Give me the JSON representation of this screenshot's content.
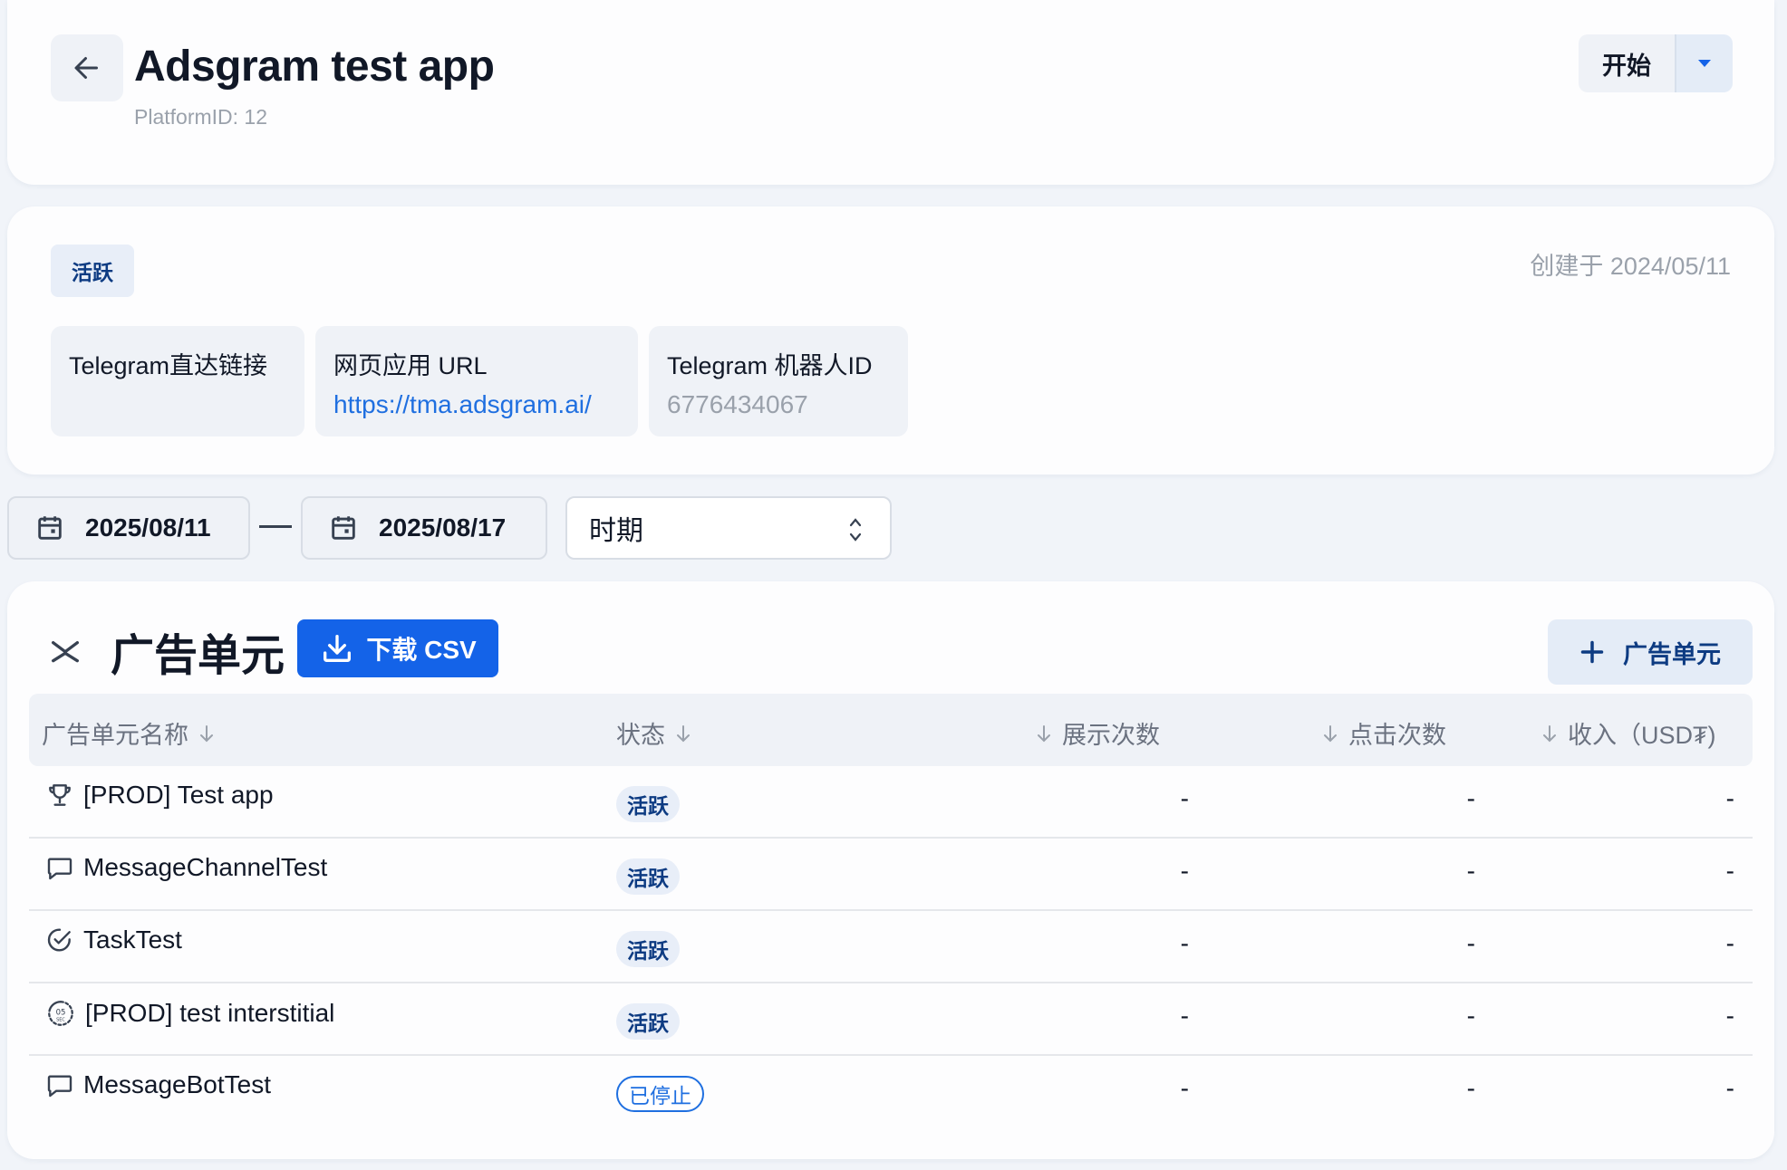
{
  "header": {
    "title": "Adsgram test app",
    "platform_id": "PlatformID: 12",
    "start_label": "开始"
  },
  "info": {
    "status": "活跃",
    "created": "创建于 2024/05/11",
    "tiles": [
      {
        "label": "Telegram直达链接",
        "value": ""
      },
      {
        "label": "网页应用 URL",
        "value": "https://tma.adsgram.ai/"
      },
      {
        "label": "Telegram 机器人ID",
        "value": "6776434067"
      }
    ]
  },
  "filters": {
    "start_date": "2025/08/11",
    "end_date": "2025/08/17",
    "period_label": "时期"
  },
  "units": {
    "title": "广告单元",
    "csv_label": "下载 CSV",
    "add_label": "广告单元",
    "columns": {
      "name": "广告单元名称",
      "status": "状态",
      "impressions": "展示次数",
      "clicks": "点击次数",
      "revenue": "收入（USD₮)"
    },
    "rows": [
      {
        "icon": "trophy-icon",
        "name": "[PROD] Test app",
        "status": "活跃",
        "impressions": "-",
        "clicks": "-",
        "revenue": "-"
      },
      {
        "icon": "message-icon",
        "name": "MessageChannelTest",
        "status": "活跃",
        "impressions": "-",
        "clicks": "-",
        "revenue": "-"
      },
      {
        "icon": "check-circle-icon",
        "name": "TaskTest",
        "status": "活跃",
        "impressions": "-",
        "clicks": "-",
        "revenue": "-"
      },
      {
        "icon": "timer-icon",
        "name": "[PROD] test interstitial",
        "status": "活跃",
        "impressions": "-",
        "clicks": "-",
        "revenue": "-"
      },
      {
        "icon": "message-icon",
        "name": "MessageBotTest",
        "status": "已停止",
        "impressions": "-",
        "clicks": "-",
        "revenue": "-"
      }
    ]
  },
  "colors": {
    "accent": "#1463e8",
    "badge_text": "#0d3b82",
    "link": "#1f6fe0"
  }
}
